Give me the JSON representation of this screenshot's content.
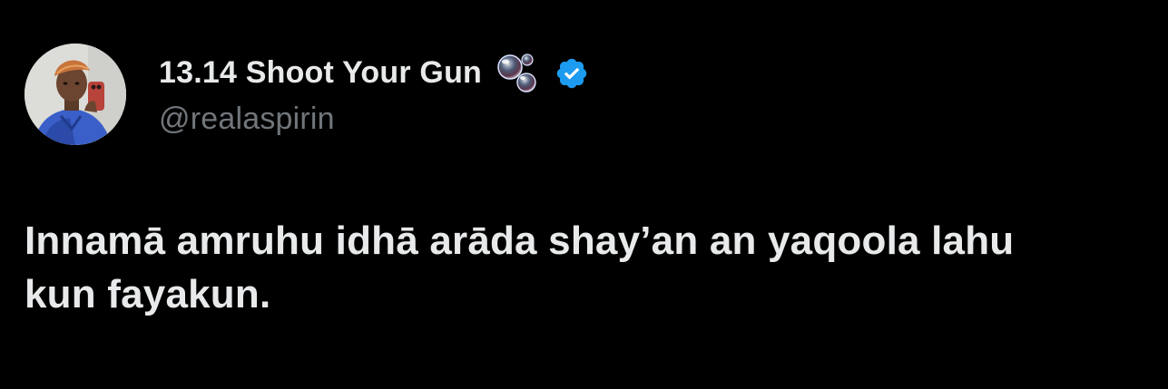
{
  "author": {
    "display_name": "13.14 Shoot Your Gun",
    "handle": "@realaspirin",
    "avatar_icon": "profile-photo",
    "name_emoji_icon": "bubbles-icon",
    "verified_icon": "verified-badge-icon",
    "verified_color": "#1d9bf0"
  },
  "tweet": {
    "lines": [
      "Innamā amruhu idhā arāda shay’an an yaqoola lahu",
      "kun fayakun."
    ]
  },
  "colors": {
    "background": "#000000",
    "primary_text": "#e7e9ea",
    "secondary_text": "#71767b"
  }
}
